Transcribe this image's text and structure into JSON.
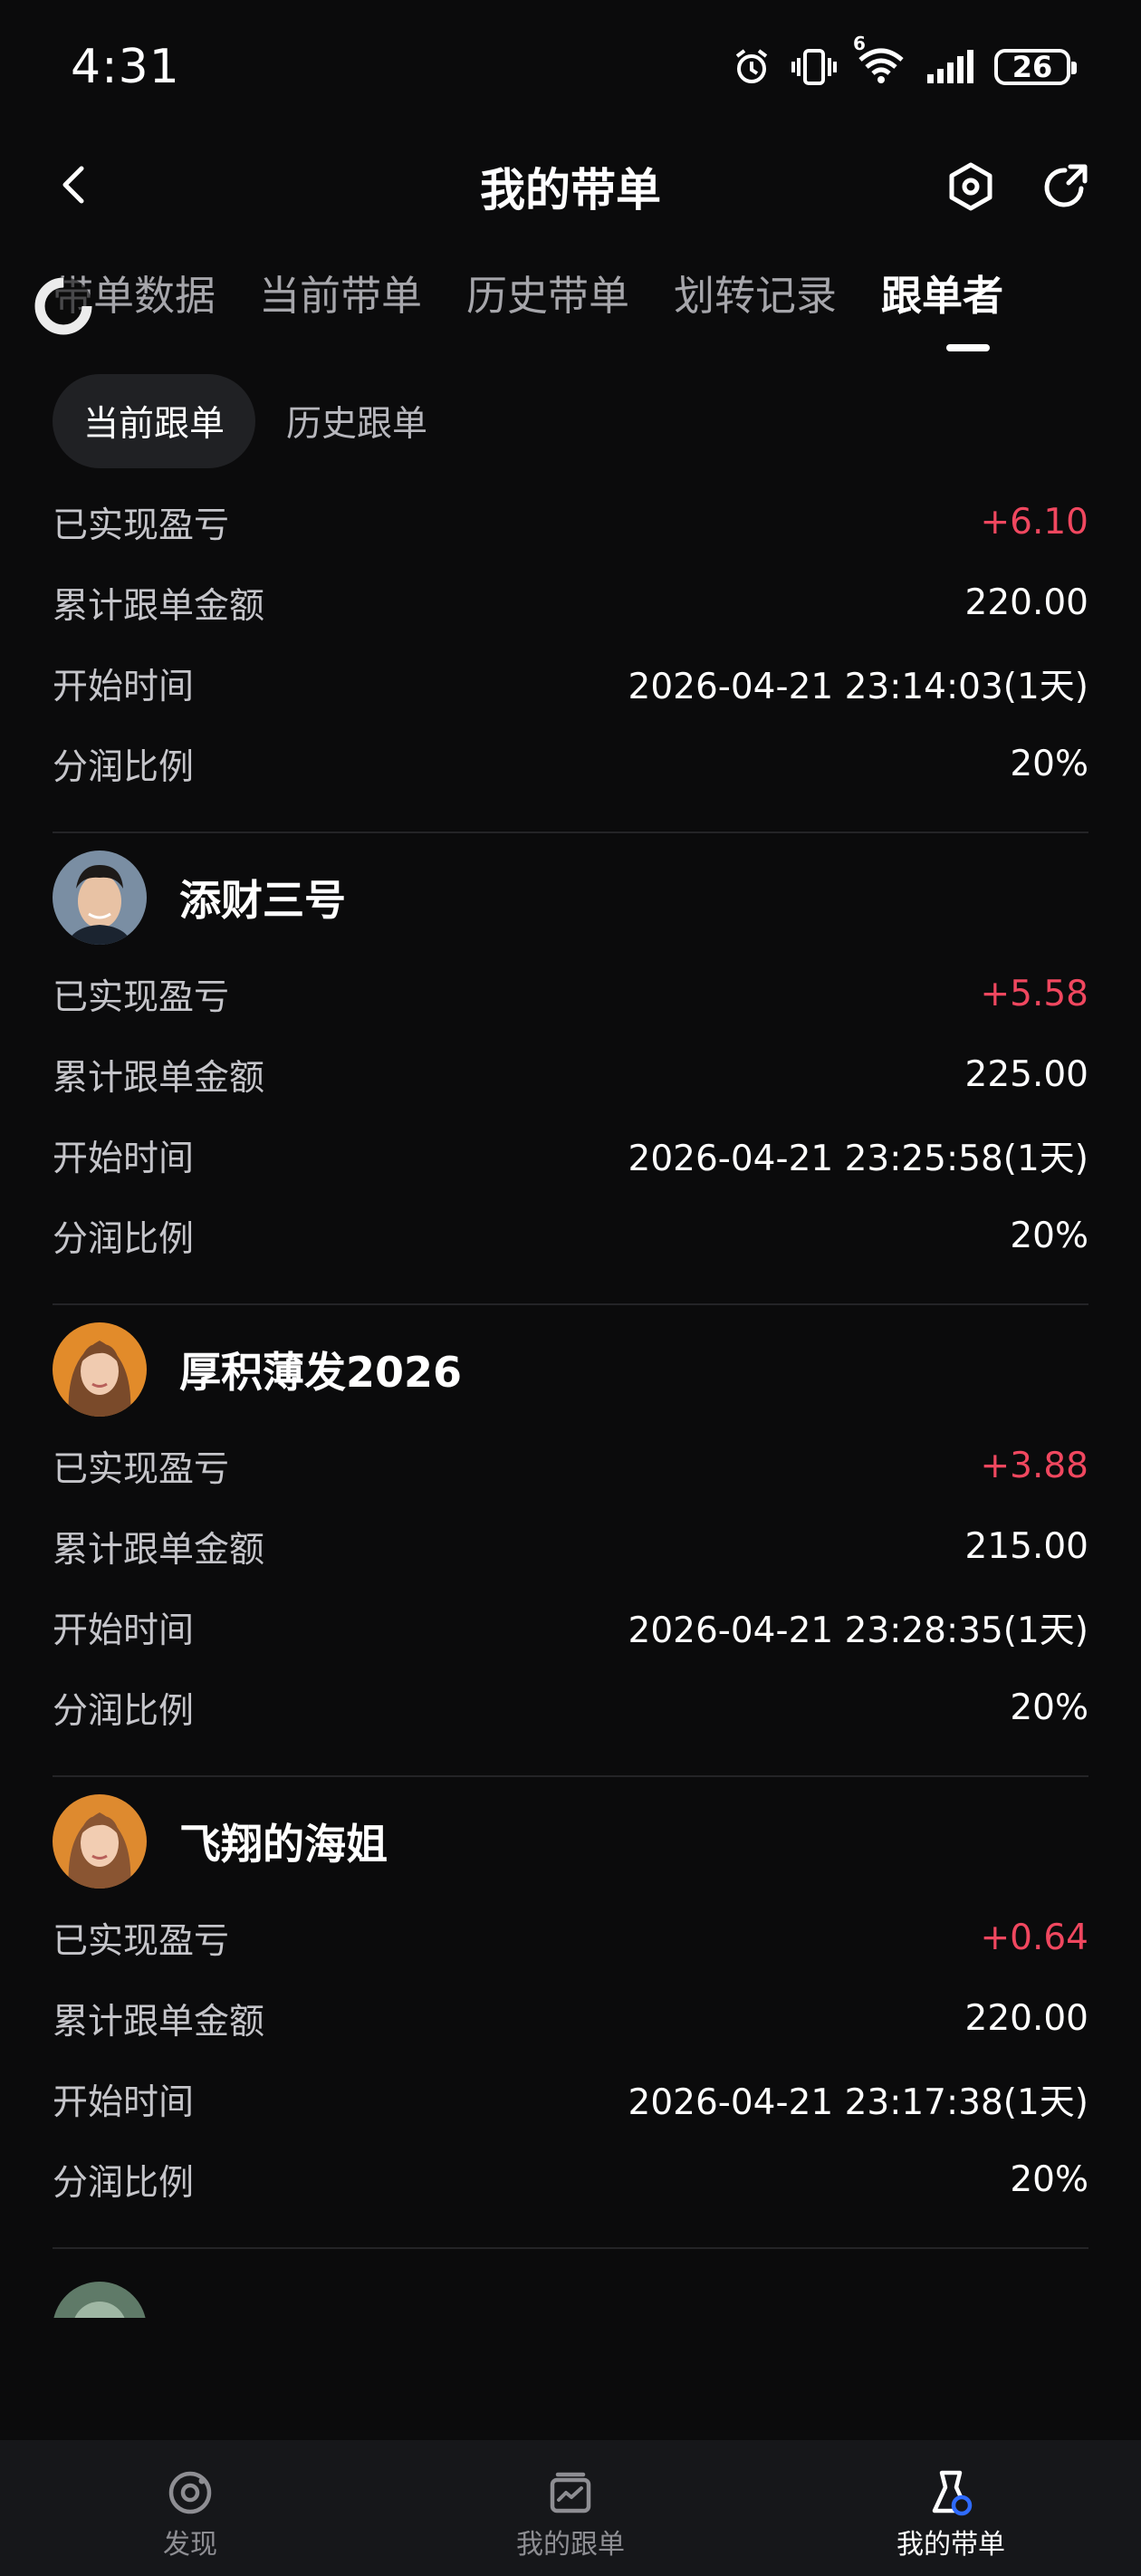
{
  "status": {
    "time": "4:31",
    "battery": "26",
    "network": "6"
  },
  "header": {
    "title": "我的带单",
    "back_icon": "back-arrow-icon",
    "settings_icon": "hexagon-settings-icon",
    "share_icon": "share-icon"
  },
  "tabs": [
    {
      "label": "带单数据"
    },
    {
      "label": "当前带单"
    },
    {
      "label": "历史带单"
    },
    {
      "label": "划转记录"
    },
    {
      "label": "跟单者",
      "active": true
    }
  ],
  "subtabs": [
    {
      "label": "当前跟单",
      "active": true
    },
    {
      "label": "历史跟单"
    }
  ],
  "field_labels": {
    "pnl": "已实现盈亏",
    "amount": "累计跟单金额",
    "start": "开始时间",
    "share": "分润比例"
  },
  "followers": [
    {
      "name": "",
      "pnl": "+6.10",
      "amount": "220.00",
      "start": "2026-04-21 23:14:03(1天)",
      "share": "20%"
    },
    {
      "name": "添财三号",
      "pnl": "+5.58",
      "amount": "225.00",
      "start": "2026-04-21 23:25:58(1天)",
      "share": "20%"
    },
    {
      "name": "厚积薄发2026",
      "pnl": "+3.88",
      "amount": "215.00",
      "start": "2026-04-21 23:28:35(1天)",
      "share": "20%"
    },
    {
      "name": "飞翔的海姐",
      "pnl": "+0.64",
      "amount": "220.00",
      "start": "2026-04-21 23:17:38(1天)",
      "share": "20%"
    }
  ],
  "bottom_nav": [
    {
      "label": "发现",
      "icon": "discover-icon"
    },
    {
      "label": "我的跟单",
      "icon": "copy-trade-icon"
    },
    {
      "label": "我的带单",
      "icon": "lead-trade-icon",
      "active": true
    }
  ],
  "colors": {
    "background": "#0b0b0c",
    "profit": "#f0475f",
    "bottom_bar": "#16171a"
  }
}
